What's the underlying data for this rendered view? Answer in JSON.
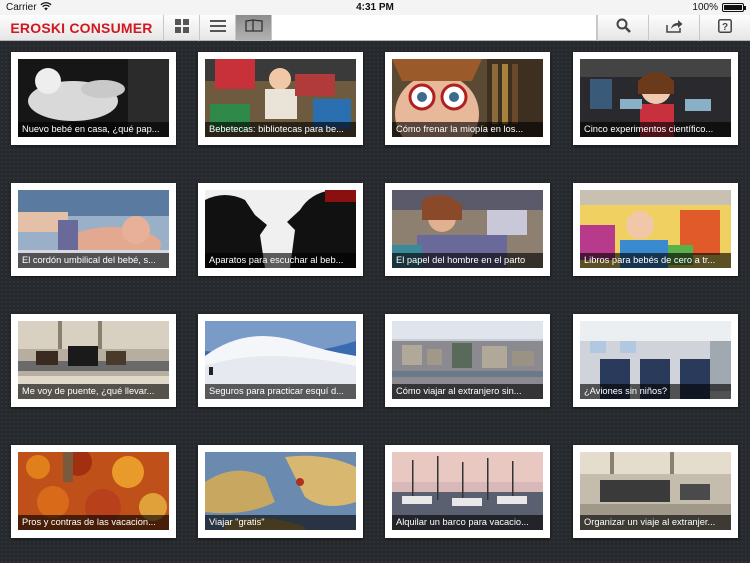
{
  "status": {
    "carrier": "Carrier",
    "time": "4:31 PM",
    "battery": "100%",
    "battery_level": 1.0
  },
  "toolbar": {
    "logo": "EROSKI CONSUMER",
    "buttons": [
      {
        "icon": "grid-view-icon"
      },
      {
        "icon": "list-view-icon"
      },
      {
        "icon": "magazine-view-icon",
        "active": true
      }
    ],
    "right_buttons": [
      {
        "icon": "search-icon"
      },
      {
        "icon": "share-icon"
      },
      {
        "icon": "help-icon"
      }
    ]
  },
  "articles": [
    {
      "title": "Nuevo bebé en casa, ¿qué pap...",
      "scene": "baby-bw"
    },
    {
      "title": "Bebetecas: bibliotecas para be...",
      "scene": "baby-books"
    },
    {
      "title": "Cómo frenar la miopía en los...",
      "scene": "girl-glasses"
    },
    {
      "title": "Cinco experimentos científico...",
      "scene": "girl-science"
    },
    {
      "title": "El cordón umbilical del bebé, s...",
      "scene": "newborn"
    },
    {
      "title": "Aparatos para escuchar al beb...",
      "scene": "silhouette"
    },
    {
      "title": "El papel del hombre en el parto",
      "scene": "delivery"
    },
    {
      "title": "Libros para bebés de cero a tr...",
      "scene": "baby-reading"
    },
    {
      "title": "Me voy de puente, ¿qué llevar...",
      "scene": "airport"
    },
    {
      "title": "Seguros para practicar esquí d...",
      "scene": "snow"
    },
    {
      "title": "Cómo viajar al extranjero sin...",
      "scene": "city"
    },
    {
      "title": "¿Aviones sin niños?",
      "scene": "plane-cabin"
    },
    {
      "title": "Pros y contras de las vacacion...",
      "scene": "autumn"
    },
    {
      "title": "Viajar \"gratis\"",
      "scene": "map"
    },
    {
      "title": "Alquilar un barco para vacacio...",
      "scene": "marina"
    },
    {
      "title": "Organizar un viaje al extranjer...",
      "scene": "lounge"
    }
  ],
  "colors": {
    "brand_red": "#d01820",
    "background": "#26292d"
  }
}
